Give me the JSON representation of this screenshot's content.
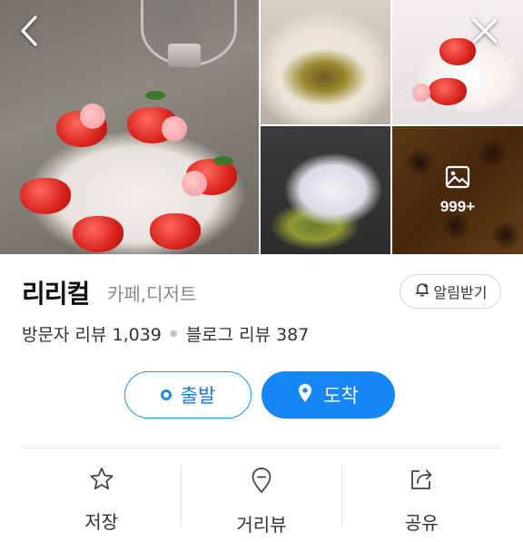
{
  "gallery": {
    "more_count": "999+"
  },
  "place": {
    "name": "리리컬",
    "category": "카페,디저트",
    "alarm_label": "알림받기"
  },
  "reviews": {
    "visitor": "방문자 리뷰 1,039",
    "blog": "블로그 리뷰 387"
  },
  "route": {
    "depart": "출발",
    "arrive": "도착"
  },
  "actions": {
    "save": "저장",
    "street_view": "거리뷰",
    "share": "공유"
  },
  "colors": {
    "accent": "#1886f5",
    "accent_text": "#1a73d9"
  },
  "icons": [
    "back-arrow-icon",
    "close-icon",
    "image-icon",
    "bell-plus-icon",
    "ring-icon",
    "location-pin-icon",
    "star-icon",
    "street-view-pin-icon",
    "share-icon"
  ]
}
